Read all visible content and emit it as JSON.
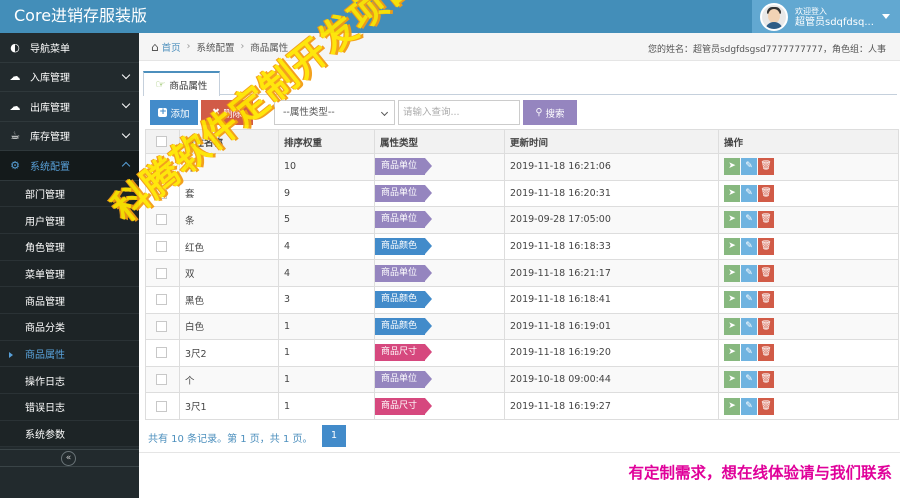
{
  "app": {
    "title": "Core进销存服装版"
  },
  "user": {
    "greeting": "欢迎登入",
    "name": "超管员sdqfdsq..."
  },
  "sidebar": {
    "items": [
      {
        "label": "导航菜单",
        "icon": "dashboard-icon"
      },
      {
        "label": "入库管理",
        "icon": "cloud-upload-icon"
      },
      {
        "label": "出库管理",
        "icon": "cloud-download-icon"
      },
      {
        "label": "库存管理",
        "icon": "coffee-icon"
      },
      {
        "label": "系统配置",
        "icon": "gear-icon"
      }
    ],
    "subitems": [
      "部门管理",
      "用户管理",
      "角色管理",
      "菜单管理",
      "商品管理",
      "商品分类",
      "商品属性",
      "操作日志",
      "错误日志",
      "系统参数"
    ]
  },
  "breadcrumb": {
    "home": "首页",
    "section": "系统配置",
    "page": "商品属性",
    "right": "您的姓名：超管员sdgfdsgsd7777777777，角色组：人事"
  },
  "tab": {
    "label": "商品属性"
  },
  "toolbar": {
    "add_label": "添加",
    "delete_label": "删除",
    "select_value": "--属性类型--",
    "search_placeholder": "请输入查询...",
    "search_label": "搜索"
  },
  "table": {
    "headers": [
      "属性名称",
      "排序权重",
      "属性类型",
      "更新时间",
      "操作"
    ],
    "rows": [
      {
        "name": "件",
        "weight": "10",
        "type": "商品单位",
        "time": "2019-11-18 16:21:06"
      },
      {
        "name": "套",
        "weight": "9",
        "type": "商品单位",
        "time": "2019-11-18 16:20:31"
      },
      {
        "name": "条",
        "weight": "5",
        "type": "商品单位",
        "time": "2019-09-28 17:05:00"
      },
      {
        "name": "红色",
        "weight": "4",
        "type": "商品颜色",
        "time": "2019-11-18 16:18:33"
      },
      {
        "name": "双",
        "weight": "4",
        "type": "商品单位",
        "time": "2019-11-18 16:21:17"
      },
      {
        "name": "黑色",
        "weight": "3",
        "type": "商品颜色",
        "time": "2019-11-18 16:18:41"
      },
      {
        "name": "白色",
        "weight": "1",
        "type": "商品颜色",
        "time": "2019-11-18 16:19:01"
      },
      {
        "name": "3尺2",
        "weight": "1",
        "type": "商品尺寸",
        "time": "2019-11-18 16:19:20"
      },
      {
        "name": "个",
        "weight": "1",
        "type": "商品单位",
        "time": "2019-10-18 09:00:44"
      },
      {
        "name": "3尺1",
        "weight": "1",
        "type": "商品尺寸",
        "time": "2019-11-18 16:19:27"
      }
    ]
  },
  "type_colors": {
    "商品单位": "#9585bf",
    "商品颜色": "#428bca",
    "商品尺寸": "#d6487e"
  },
  "pager": {
    "summary": "共有 10 条记录。第 1 页，共 1 页。",
    "current": "1"
  },
  "watermark": "科腾软件定制开发项目之一",
  "footer_note": "有定制需求，想在线体验请与我们联系"
}
